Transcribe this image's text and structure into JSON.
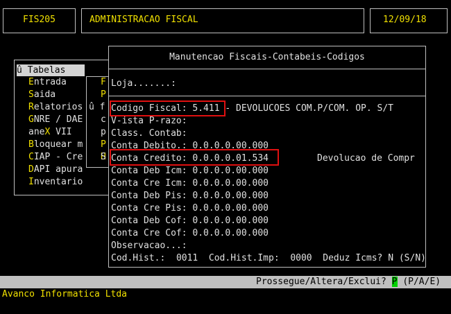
{
  "header": {
    "program_code": "FIS205",
    "module_title": "ADMINISTRACAO FISCAL",
    "date": "12/09/18"
  },
  "left_menu": {
    "title": "û Tabelas",
    "items": [
      {
        "hotkey": "E",
        "rest": "ntrada"
      },
      {
        "hotkey": "S",
        "rest": "aida"
      },
      {
        "hotkey": "R",
        "rest": "elatorios"
      },
      {
        "hotkey": "G",
        "rest": "NRE / DAE"
      },
      {
        "pre": "ane",
        "hotkey": "X",
        "rest": " VII"
      },
      {
        "hotkey": "B",
        "rest": "loquear m"
      },
      {
        "hotkey": "C",
        "rest": "IAP - Cre"
      },
      {
        "hotkey": "D",
        "rest": "API apura"
      },
      {
        "hotkey": "I",
        "rest": "nventario"
      }
    ]
  },
  "sub_menu": {
    "items": [
      {
        "hotkey": "F",
        "rest": ""
      },
      {
        "hotkey": "P",
        "rest": ""
      },
      {
        "hotkey": "",
        "rest": "û f"
      },
      {
        "hotkey": "",
        "rest": "c"
      },
      {
        "hotkey": "",
        "rest": "p"
      },
      {
        "hotkey": "P",
        "rest": ""
      },
      {
        "hotkey": "H",
        "rest": ""
      },
      {
        "hotkey": "",
        "rest": "S"
      }
    ]
  },
  "dialog": {
    "title": "Manutencao Fiscais-Contabeis-Codigos",
    "loja_label": "Loja.......:",
    "fields": [
      {
        "label": "Codigo Fiscal:",
        "value": "5.411",
        "extra": "- DEVOLUCOES COM.P/COM. OP. S/T"
      },
      {
        "label": "V-ista P-razo:",
        "value": "",
        "extra": ""
      },
      {
        "label": "Class. Contab:",
        "value": "",
        "extra": ""
      },
      {
        "label": "Conta Debito.:",
        "value": "0.0.0.0.00.000",
        "extra": ""
      },
      {
        "label": "Conta Credito:",
        "value": "0.0.0.0.01.534",
        "extra": "Devolucao de Compr"
      },
      {
        "label": "Conta Deb Icm:",
        "value": "0.0.0.0.00.000",
        "extra": ""
      },
      {
        "label": "Conta Cre Icm:",
        "value": "0.0.0.0.00.000",
        "extra": ""
      },
      {
        "label": "Conta Deb Pis:",
        "value": "0.0.0.0.00.000",
        "extra": ""
      },
      {
        "label": "Conta Cre Pis:",
        "value": "0.0.0.0.00.000",
        "extra": ""
      },
      {
        "label": "Conta Deb Cof:",
        "value": "0.0.0.0.00.000",
        "extra": ""
      },
      {
        "label": "Conta Cre Cof:",
        "value": "0.0.0.0.00.000",
        "extra": ""
      },
      {
        "label": "Observacao...:",
        "value": "",
        "extra": ""
      }
    ],
    "bottom": {
      "cod_hist_label": "Cod.Hist.:",
      "cod_hist_value": "0011",
      "cod_hist_imp_label": "Cod.Hist.Imp:",
      "cod_hist_imp_value": "0000",
      "deduz_label": "Deduz Icms?",
      "deduz_value": "N",
      "deduz_options": "(S/N)"
    }
  },
  "status_bar": {
    "prompt": "Prossegue/Altera/Exclui?",
    "input_value": "P",
    "options": "(P/A/E)"
  },
  "footer": {
    "company": "Avanco Informatica Ltda"
  }
}
